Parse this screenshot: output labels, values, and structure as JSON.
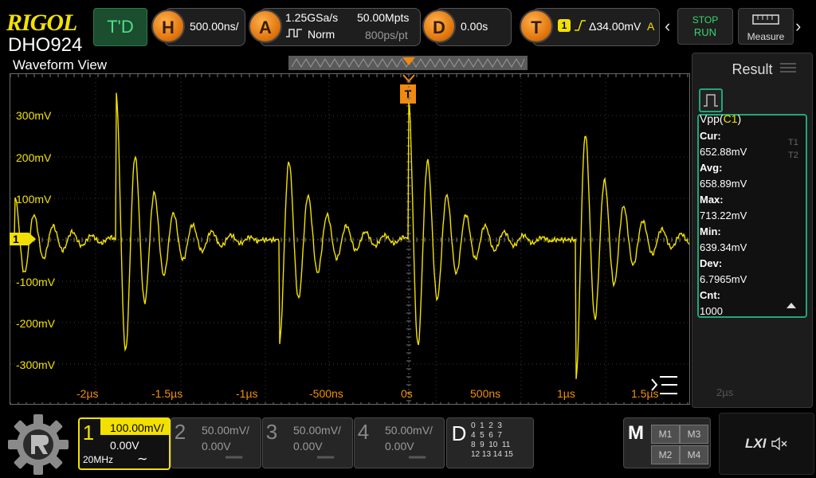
{
  "brand": {
    "logo": "RIGOL",
    "model": "DHO924"
  },
  "topbar": {
    "trigger_delay_label": "T'D",
    "horizontal": {
      "letter": "H",
      "timebase": "500.00ns/"
    },
    "acquire": {
      "letter": "A",
      "sample_rate": "1.25GSa/s",
      "mode": "Norm",
      "mem_depth": "50.00Mpts",
      "points_per_time": "800ps/pt"
    },
    "delay": {
      "letter": "D",
      "value": "0.00s"
    },
    "trigger": {
      "letter": "T",
      "source": "1",
      "level": "Δ34.00mV",
      "suffix": "A"
    },
    "stop_label": "STOP",
    "run_label": "RUN",
    "measure_label": "Measure"
  },
  "waveform": {
    "title": "Waveform View",
    "trigger_marker": "T",
    "channel_marker": "1",
    "y_labels": [
      "300mV",
      "200mV",
      "100mV",
      "-100mV",
      "-200mV",
      "-300mV"
    ],
    "x_labels": [
      "-2µs",
      "-1.5µs",
      "-1µs",
      "-500ns",
      "0s",
      "500ns",
      "1µs",
      "1.5µs"
    ],
    "x_label_right": "2µs"
  },
  "result": {
    "title": "Result",
    "measurement": "Vpp",
    "channel": "C1",
    "items": [
      {
        "label": "Cur:",
        "value": "652.88mV"
      },
      {
        "label": "Avg:",
        "value": "658.89mV"
      },
      {
        "label": "Max:",
        "value": "713.22mV"
      },
      {
        "label": "Min:",
        "value": "639.34mV"
      },
      {
        "label": "Dev:",
        "value": "6.7965mV"
      },
      {
        "label": "Cnt:",
        "value": "1000"
      }
    ],
    "side_tabs": [
      "T1",
      "T2"
    ]
  },
  "channels": [
    {
      "num": "1",
      "scale": "100.00mV/",
      "offset": "0.00V",
      "bw": "20MHz",
      "active": true
    },
    {
      "num": "2",
      "scale": "50.00mV/",
      "offset": "0.00V",
      "active": false
    },
    {
      "num": "3",
      "scale": "50.00mV/",
      "offset": "0.00V",
      "active": false
    },
    {
      "num": "4",
      "scale": "50.00mV/",
      "offset": "0.00V",
      "active": false
    }
  ],
  "digital": {
    "letter": "D",
    "rows": [
      "0  1  2  3",
      "4  5  6  7",
      "8  9  10  11",
      "12 13 14 15"
    ]
  },
  "math": {
    "letter": "M",
    "cells": [
      "M1",
      "M3",
      "M2",
      "M4"
    ]
  },
  "lxi": {
    "label": "LXI"
  },
  "colors": {
    "ch1": "#f2e100",
    "accent": "#f2910c",
    "green": "#22a676"
  }
}
